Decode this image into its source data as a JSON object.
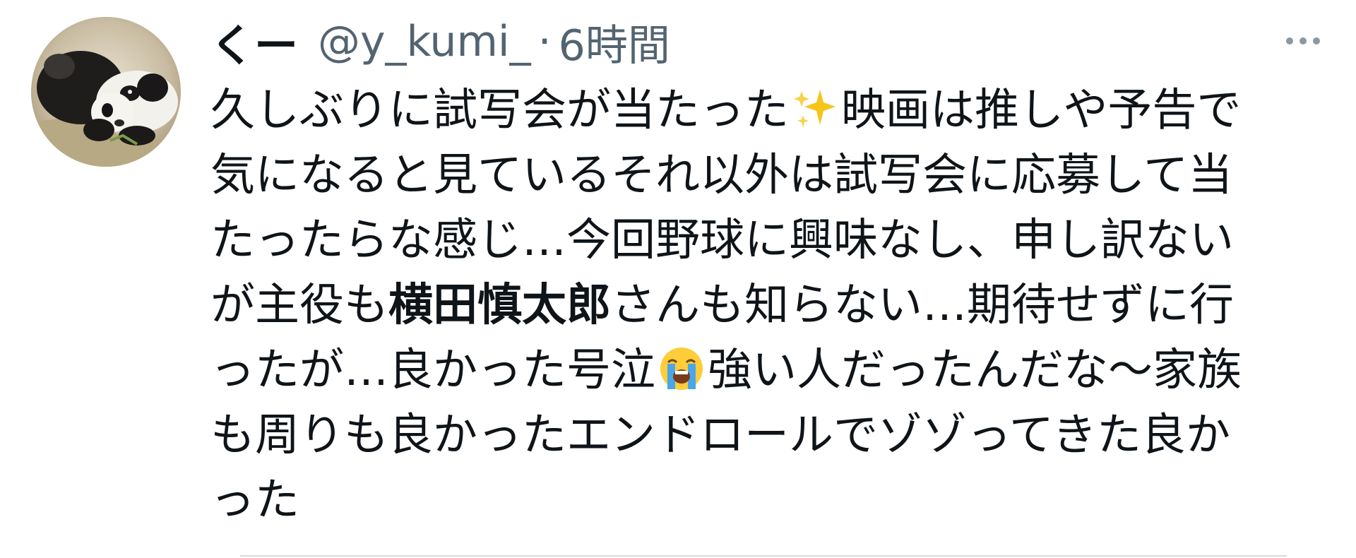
{
  "tweet": {
    "avatar_icon": "panda-avatar-icon",
    "display_name": "くー",
    "handle": "@y_kumi_",
    "separator": "·",
    "timestamp": "6時間",
    "more_icon": "more-options-icon",
    "body_lines": [
      {
        "segments": [
          {
            "text": "久しぶりに試写会が当たった"
          },
          {
            "emoji": "sparkles-emoji"
          },
          {
            "text": "映画は推しや予告で"
          }
        ]
      },
      {
        "segments": [
          {
            "text": "気になると見ているそれ以外は試写会に応募して当"
          }
        ]
      },
      {
        "segments": [
          {
            "text": "たったらな感じ…今回野球に興味なし、申し訳ない"
          }
        ]
      },
      {
        "segments": [
          {
            "text": "が主役も"
          },
          {
            "text": "横田慎太郎",
            "bold": true
          },
          {
            "text": "さんも知らない…期待せずに行"
          }
        ]
      },
      {
        "segments": [
          {
            "text": "ったが…良かった号泣"
          },
          {
            "emoji": "loudly-crying-face-emoji"
          },
          {
            "text": "強い人だったんだな〜家族"
          }
        ]
      },
      {
        "segments": [
          {
            "text": "も周りも良かったエンドロールでゾゾってきた良か"
          }
        ]
      },
      {
        "segments": [
          {
            "text": "った"
          }
        ]
      }
    ]
  },
  "colors": {
    "text_primary": "#0f1419",
    "text_secondary": "#536471",
    "more_icon": "#8b98a5",
    "divider": "#d9d9d9"
  }
}
